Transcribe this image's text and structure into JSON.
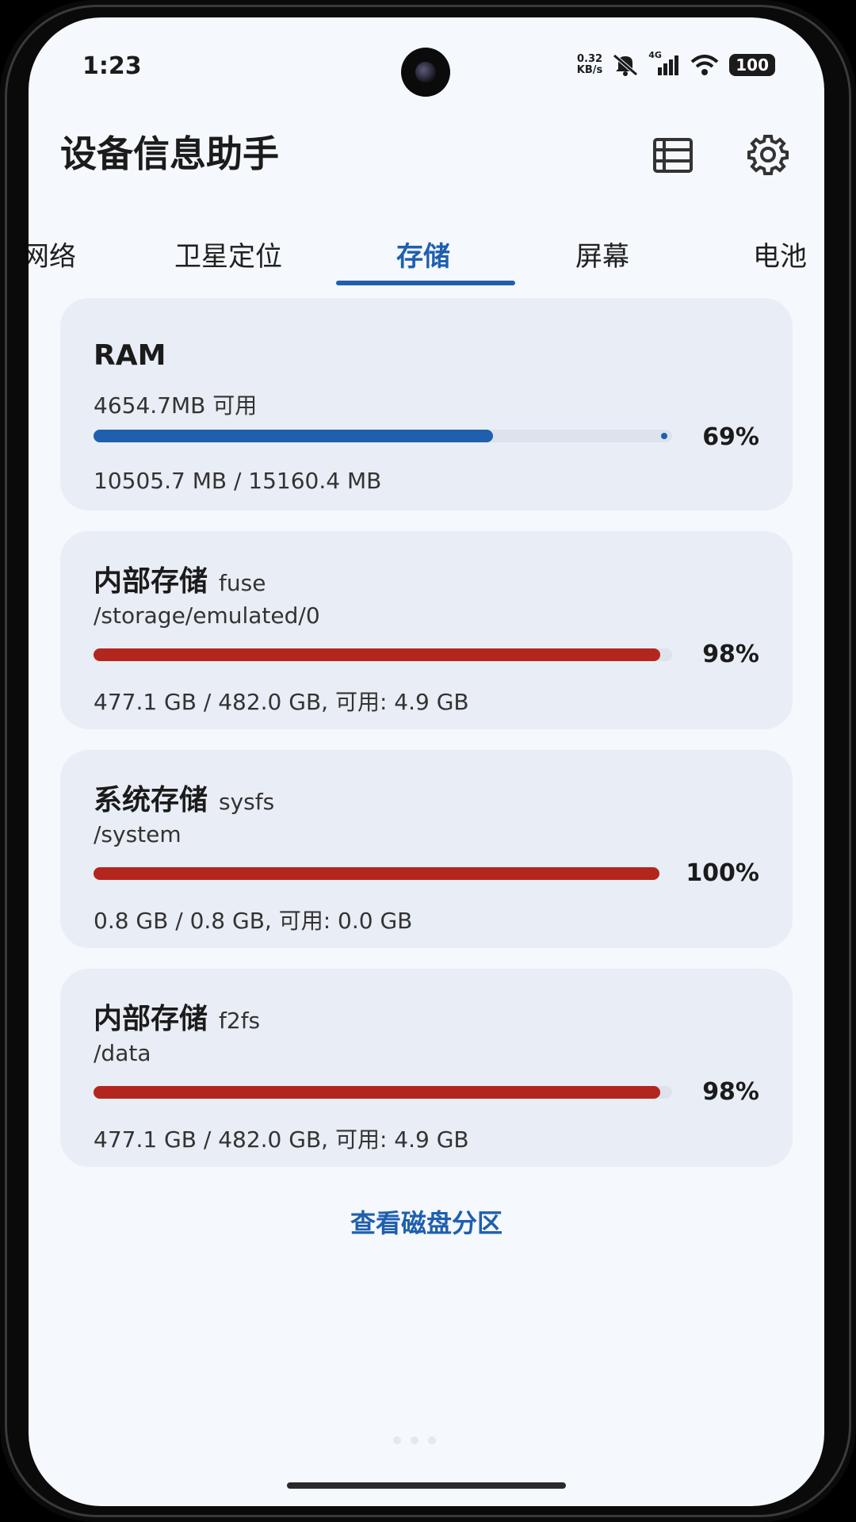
{
  "status_bar": {
    "time": "1:23",
    "net_speed_value": "0.32",
    "net_speed_unit": "KB/s",
    "signal_label": "4G",
    "battery": "100"
  },
  "header": {
    "title": "设备信息助手",
    "icons": [
      "list-icon",
      "gear-icon"
    ]
  },
  "tabs": [
    {
      "label": "网络",
      "active": false
    },
    {
      "label": "卫星定位",
      "active": false
    },
    {
      "label": "存储",
      "active": true
    },
    {
      "label": "屏幕",
      "active": false
    },
    {
      "label": "电池",
      "active": false
    }
  ],
  "cards": [
    {
      "title": "RAM",
      "fs": "",
      "subtitle": "4654.7MB 可用",
      "percent_label": "69%",
      "fraction": 0.69,
      "detail": "10505.7 MB / 15160.4 MB",
      "bar_color": "#1f5fae"
    },
    {
      "title": "内部存储",
      "fs": "fuse",
      "subtitle": "/storage/emulated/0",
      "percent_label": "98%",
      "fraction": 0.98,
      "detail": "477.1 GB / 482.0 GB, 可用: 4.9 GB",
      "bar_color": "#b3261e"
    },
    {
      "title": "系统存储",
      "fs": "sysfs",
      "subtitle": "/system",
      "percent_label": "100%",
      "fraction": 1.0,
      "detail": "0.8 GB / 0.8 GB, 可用: 0.0 GB",
      "bar_color": "#b3261e"
    },
    {
      "title": "内部存储",
      "fs": "f2fs",
      "subtitle": "/data",
      "percent_label": "98%",
      "fraction": 0.98,
      "detail": "477.1 GB / 482.0 GB, 可用: 4.9 GB",
      "bar_color": "#b3261e"
    }
  ],
  "actions": {
    "view_partitions": "查看磁盘分区"
  },
  "colors": {
    "accent": "#1f5fae",
    "danger": "#b3261e",
    "card_bg": "#e9edf5",
    "screen_bg": "#f5f8fd"
  }
}
